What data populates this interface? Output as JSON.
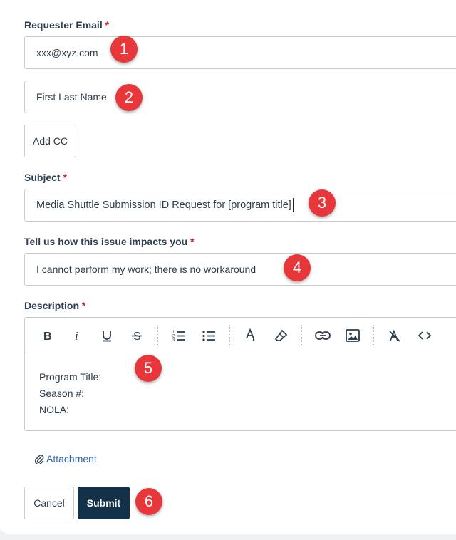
{
  "form": {
    "requester_email": {
      "label": "Requester Email",
      "required_mark": "*",
      "value": "xxx@xyz.com"
    },
    "name_field": {
      "value": "First Last Name"
    },
    "add_cc_label": "Add CC",
    "subject": {
      "label": "Subject",
      "required_mark": "*",
      "value": "Media Shuttle Submission ID Request for [program title]"
    },
    "impact": {
      "label": "Tell us how this issue impacts you",
      "required_mark": "*",
      "value": "I cannot perform my work; there is no workaround"
    },
    "description": {
      "label": "Description",
      "required_mark": "*",
      "lines": [
        "Program Title:",
        "Season #:",
        "NOLA:"
      ],
      "toolbar_icons": [
        "bold-icon",
        "italic-icon",
        "underline-icon",
        "strikethrough-icon",
        "ordered-list-icon",
        "bullet-list-icon",
        "text-color-icon",
        "highlight-icon",
        "link-icon",
        "image-icon",
        "clear-format-icon",
        "code-icon"
      ]
    },
    "attachment_label": "Attachment",
    "cancel_label": "Cancel",
    "submit_label": "Submit"
  },
  "callouts": [
    "1",
    "2",
    "3",
    "4",
    "5",
    "6"
  ],
  "colors": {
    "primary": "#14314a",
    "required": "#d0212a",
    "link": "#2f63b8",
    "callout": "#e8373a"
  }
}
